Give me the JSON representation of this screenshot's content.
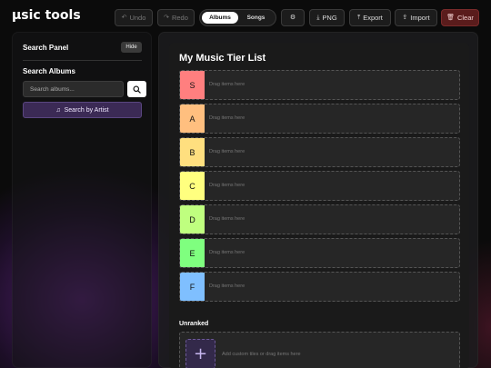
{
  "app": {
    "title": "µsic tools"
  },
  "toolbar": {
    "undo_label": "Undo",
    "redo_label": "Redo",
    "mode_options": [
      "Albums",
      "Songs"
    ],
    "mode_selected": "Albums",
    "png_label": "PNG",
    "export_label": "Export",
    "import_label": "Import",
    "clear_label": "Clear",
    "icons": {
      "undo": "undo-icon",
      "redo": "redo-icon",
      "settings": "settings-icon",
      "png": "download-icon",
      "export": "upload-icon",
      "import": "import-icon",
      "clear": "trash-icon"
    }
  },
  "sidebar": {
    "title": "Search Panel",
    "hide_label": "Hide",
    "section_title": "Search Albums",
    "search_placeholder": "Search albums...",
    "search_button_icon": "search-icon",
    "artist_button_label": "Search by Artist",
    "artist_button_icon": "music-note-icon"
  },
  "tierlist": {
    "title": "My Music Tier List",
    "tiers": [
      {
        "label": "S",
        "color": "#ff7f7f",
        "hint": "Drag items here"
      },
      {
        "label": "A",
        "color": "#ffbf7f",
        "hint": "Drag items here"
      },
      {
        "label": "B",
        "color": "#ffdf7f",
        "hint": "Drag items here"
      },
      {
        "label": "C",
        "color": "#ffff7f",
        "hint": "Drag items here"
      },
      {
        "label": "D",
        "color": "#bfff7f",
        "hint": "Drag items here"
      },
      {
        "label": "E",
        "color": "#7fff7f",
        "hint": "Drag items here"
      },
      {
        "label": "F",
        "color": "#7fbfff",
        "hint": "Drag items here"
      }
    ],
    "unranked": {
      "title": "Unranked",
      "hint": "Add custom tiles or drag items here",
      "add_icon": "plus-icon"
    }
  },
  "colors": {
    "accent_purple": "#3b2a55",
    "danger": "#5a1c1c"
  }
}
